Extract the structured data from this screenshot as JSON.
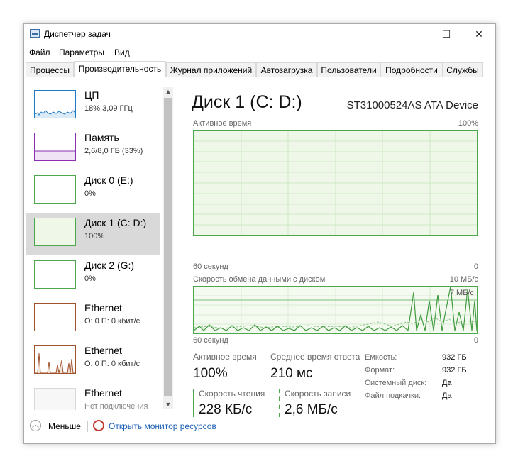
{
  "window": {
    "title": "Диспетчер задач",
    "controls": {
      "minimize": "—",
      "maximize": "☐",
      "close": "✕"
    }
  },
  "menu": [
    "Файл",
    "Параметры",
    "Вид"
  ],
  "tabs": [
    "Процессы",
    "Производительность",
    "Журнал приложений",
    "Автозагрузка",
    "Пользователи",
    "Подробности",
    "Службы"
  ],
  "active_tab": "Производительность",
  "sidebar": [
    {
      "title": "ЦП",
      "sub": "18% 3,09 ГГц",
      "color": "#1e79c6"
    },
    {
      "title": "Память",
      "sub": "2,6/8,0 ГБ (33%)",
      "color": "#8b2fb0"
    },
    {
      "title": "Диск 0 (E:)",
      "sub": "0%",
      "color": "#4ca84c"
    },
    {
      "title": "Диск 1 (C: D:)",
      "sub": "100%",
      "color": "#4ca84c",
      "selected": true
    },
    {
      "title": "Диск 2 (G:)",
      "sub": "0%",
      "color": "#4ca84c"
    },
    {
      "title": "Ethernet",
      "sub": "О: 0 П: 0 кбит/с",
      "color": "#a0522d"
    },
    {
      "title": "Ethernet",
      "sub": "О: 0 П: 0 кбит/с",
      "color": "#a0522d"
    },
    {
      "title": "Ethernet",
      "sub": "Нет подключения",
      "color": "#cccccc"
    }
  ],
  "detail": {
    "title": "Диск 1 (C: D:)",
    "model": "ST31000524AS ATA Device",
    "graph1": {
      "label": "Активное время",
      "max": "100%",
      "time": "60 секунд",
      "min": "0",
      "active_percent": 100
    },
    "graph2": {
      "label": "Скорость обмена данными с диском",
      "max": "10 МБ/с",
      "mid": "7 МБ/с",
      "time": "60 секунд",
      "min": "0"
    },
    "stats": {
      "active_time_label": "Активное время",
      "active_time_value": "100%",
      "avg_response_label": "Среднее время ответа",
      "avg_response_value": "210 мс",
      "read_label": "Скорость чтения",
      "read_value": "228 КБ/с",
      "write_label": "Скорость записи",
      "write_value": "2,6 МБ/с"
    },
    "props": [
      {
        "k": "Емкость:",
        "v": "932 ГБ"
      },
      {
        "k": "Формат:",
        "v": "932 ГБ"
      },
      {
        "k": "Системный диск:",
        "v": "Да"
      },
      {
        "k": "Файл подкачки:",
        "v": "Да"
      }
    ]
  },
  "footer": {
    "fewer": "Меньше",
    "resmon": "Открыть монитор ресурсов"
  },
  "colors": {
    "disk": "#4ca84c",
    "disk_fill": "#f4faef"
  }
}
